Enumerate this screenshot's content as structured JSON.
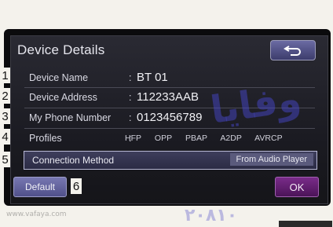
{
  "header": {
    "title": "Device Details"
  },
  "rows": [
    {
      "num": "1",
      "label": "Device Name",
      "value": "BT 01"
    },
    {
      "num": "2",
      "label": "Device Address",
      "value": "112233AAB"
    },
    {
      "num": "3",
      "label": "My Phone Number",
      "value": "0123456789"
    },
    {
      "num": "4",
      "label": "Profiles",
      "profiles": [
        "HFP",
        "OPP",
        "PBAP",
        "A2DP",
        "AVRCP"
      ]
    },
    {
      "num": "5",
      "label": "Connection Method",
      "value": "From Audio Player"
    }
  ],
  "footer": {
    "default_label": "Default",
    "num6": "6",
    "ok_label": "OK"
  },
  "watermark": {
    "main": "وفايا",
    "numbers": "۲۰۸۱۰",
    "small": "www.vafaya.com"
  },
  "icons": {
    "back": "return-arrow-icon"
  }
}
